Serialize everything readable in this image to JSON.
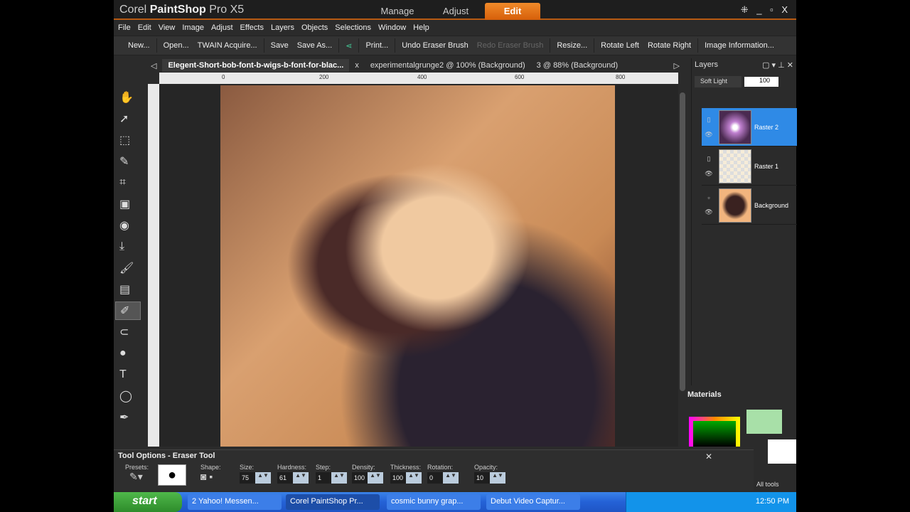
{
  "app": {
    "logo_prefix": "Corel",
    "logo_bold": "PaintShop",
    "logo_suffix": "Pro X5",
    "modes": [
      "Manage",
      "Adjust",
      "Edit"
    ],
    "active_mode": "Edit",
    "window_controls": "⁜ _ ▫ X"
  },
  "menu": [
    "File",
    "Edit",
    "View",
    "Image",
    "Adjust",
    "Effects",
    "Layers",
    "Objects",
    "Selections",
    "Window",
    "Help"
  ],
  "toolbar": {
    "new": "New...",
    "open": "Open...",
    "twain": "TWAIN Acquire...",
    "save": "Save",
    "save_as": "Save As...",
    "share_icon": "share-icon",
    "print": "Print...",
    "undo": "Undo Eraser Brush",
    "redo": "Redo Eraser Brush",
    "resize": "Resize...",
    "rotate_left": "Rotate Left",
    "rotate_right": "Rotate Right",
    "image_info": "Image Information..."
  },
  "doc_tabs": {
    "items": [
      "Elegent-Short-bob-font-b-wigs-b-font-for-blac...",
      "experimentalgrunge2 @ 100% (Background)",
      "3 @  88% (Background)"
    ],
    "close": "x"
  },
  "ruler": {
    "top": [
      "0",
      "200",
      "400",
      "600",
      "800"
    ]
  },
  "layers": {
    "title": "Layers",
    "blend_mode": "Soft Light",
    "opacity": "100",
    "items": [
      {
        "name": "Raster 2"
      },
      {
        "name": "Raster 1"
      },
      {
        "name": "Background"
      }
    ]
  },
  "materials": {
    "title": "Materials",
    "all_tools": "All tools"
  },
  "tool_options": {
    "title": "Tool Options - Eraser Tool",
    "presets": "Presets:",
    "shape": "Shape:",
    "fields": [
      {
        "label": "Size:",
        "value": "75"
      },
      {
        "label": "Hardness:",
        "value": "61"
      },
      {
        "label": "Step:",
        "value": "1"
      },
      {
        "label": "Density:",
        "value": "100"
      },
      {
        "label": "Thickness:",
        "value": "100"
      },
      {
        "label": "Rotation:",
        "value": "0"
      },
      {
        "label": "Opacity:",
        "value": "10"
      }
    ]
  },
  "taskbar": {
    "start": "start",
    "tasks": [
      "2 Yahoo! Messen...",
      "Corel PaintShop Pr...",
      "cosmic bunny grap...",
      "Debut Video Captur..."
    ],
    "clock": "12:50 PM"
  }
}
